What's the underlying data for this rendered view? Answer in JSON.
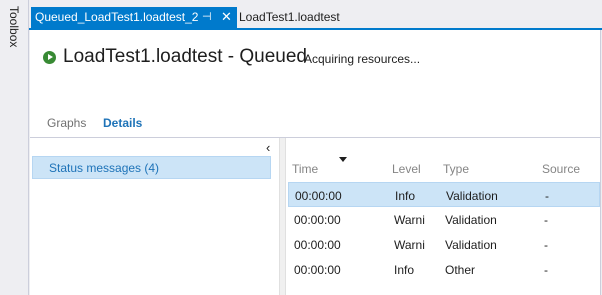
{
  "toolbox": {
    "label": "Toolbox"
  },
  "tabs": {
    "active": {
      "label": "Queued_LoadTest1.loadtest_2",
      "pin_icon": "pin-icon",
      "close_icon": "close-icon"
    },
    "inactive": {
      "label": "LoadTest1.loadtest"
    }
  },
  "header": {
    "title": "LoadTest1.loadtest - Queued",
    "status": "Acquiring resources...",
    "status_icon": "run-icon"
  },
  "subtabs": {
    "graphs": "Graphs",
    "details": "Details"
  },
  "left_panel": {
    "collapse_icon": "chevron-left-icon",
    "status_messages": "Status messages (4)"
  },
  "grid": {
    "columns": [
      "Time",
      "Level",
      "Type",
      "Source"
    ],
    "sort_column": "Time",
    "rows": [
      {
        "time": "00:00:00",
        "level": "Info",
        "type": "Validation",
        "source": "-",
        "selected": true
      },
      {
        "time": "00:00:00",
        "level": "Warni",
        "type": "Validation",
        "source": "-",
        "selected": false
      },
      {
        "time": "00:00:00",
        "level": "Warni",
        "type": "Validation",
        "source": "-",
        "selected": false
      },
      {
        "time": "00:00:00",
        "level": "Info",
        "type": "Other",
        "source": "-",
        "selected": false
      }
    ]
  },
  "colors": {
    "accent": "#007acc",
    "link": "#1e73b8",
    "selection": "#cce4f7",
    "run_green": "#388a34"
  }
}
